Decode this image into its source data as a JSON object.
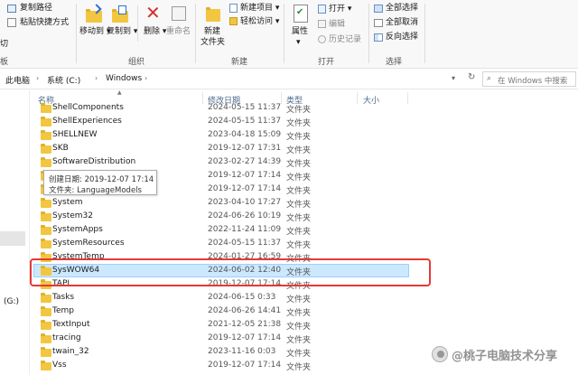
{
  "ribbon": {
    "clipboard": {
      "copy_path": "复制路径",
      "paste_shortcut": "粘贴快捷方式",
      "cut_partial": "切"
    },
    "organize": {
      "move_to": "移动到",
      "copy_to": "复制到",
      "delete": "删除",
      "rename": "重命名",
      "group_label": "组织"
    },
    "new": {
      "new_folder_l1": "新建",
      "new_folder_l2": "文件夹",
      "new_item": "新建项目",
      "easy_access": "轻松访问",
      "group_label": "新建"
    },
    "open": {
      "properties": "属性",
      "open": "打开",
      "edit": "编辑",
      "history": "历史记录",
      "group_label": "打开"
    },
    "select": {
      "select_all": "全部选择",
      "select_none": "全部取消",
      "invert": "反向选择",
      "group_label": "选择"
    },
    "left_fragment": "板"
  },
  "address": {
    "crumbs": [
      "此电脑",
      "系统 (C:)",
      "Windows"
    ],
    "search_placeholder": "在 Windows 中搜索"
  },
  "nav": {
    "drive_fragment": "(G:)"
  },
  "columns": {
    "name": "名称",
    "date": "修改日期",
    "type": "类型",
    "size": "大小"
  },
  "tooltip": {
    "created": "创建日期: 2019-12-07 17:14",
    "folders": "文件夹: LanguageModels"
  },
  "rows": [
    {
      "name": "ShellComponents",
      "date": "2024-05-15 11:37",
      "type": "文件夹"
    },
    {
      "name": "ShellExperiences",
      "date": "2024-05-15 11:37",
      "type": "文件夹"
    },
    {
      "name": "SHELLNEW",
      "date": "2023-04-18 15:09",
      "type": "文件夹"
    },
    {
      "name": "SKB",
      "date": "2019-12-07 17:31",
      "type": "文件夹"
    },
    {
      "name": "SoftwareDistribution",
      "date": "2023-02-27 14:39",
      "type": "文件夹"
    },
    {
      "name": "",
      "date": "2019-12-07 17:14",
      "type": "文件夹"
    },
    {
      "name": "",
      "date": "2019-12-07 17:14",
      "type": "文件夹"
    },
    {
      "name": "System",
      "date": "2023-04-10 17:27",
      "type": "文件夹"
    },
    {
      "name": "System32",
      "date": "2024-06-26 10:19",
      "type": "文件夹"
    },
    {
      "name": "SystemApps",
      "date": "2022-11-24 11:09",
      "type": "文件夹"
    },
    {
      "name": "SystemResources",
      "date": "2024-05-15 11:37",
      "type": "文件夹"
    },
    {
      "name": "SystemTemp",
      "date": "2024-01-27 16:59",
      "type": "文件夹"
    },
    {
      "name": "SysWOW64",
      "date": "2024-06-02 12:40",
      "type": "文件夹"
    },
    {
      "name": "TAPI",
      "date": "2019-12-07 17:14",
      "type": "文件夹"
    },
    {
      "name": "Tasks",
      "date": "2024-06-15 0:33",
      "type": "文件夹"
    },
    {
      "name": "Temp",
      "date": "2024-06-26 14:41",
      "type": "文件夹"
    },
    {
      "name": "TextInput",
      "date": "2021-12-05 21:38",
      "type": "文件夹"
    },
    {
      "name": "tracing",
      "date": "2019-12-07 17:14",
      "type": "文件夹"
    },
    {
      "name": "twain_32",
      "date": "2023-11-16 0:03",
      "type": "文件夹"
    },
    {
      "name": "Vss",
      "date": "2019-12-07 17:14",
      "type": "文件夹"
    }
  ],
  "selected_row": 12,
  "watermark": "@桃子电脑技术分享",
  "colors": {
    "selection": "#cce8ff",
    "annotation": "#e53935",
    "folder": "#f2c640"
  }
}
